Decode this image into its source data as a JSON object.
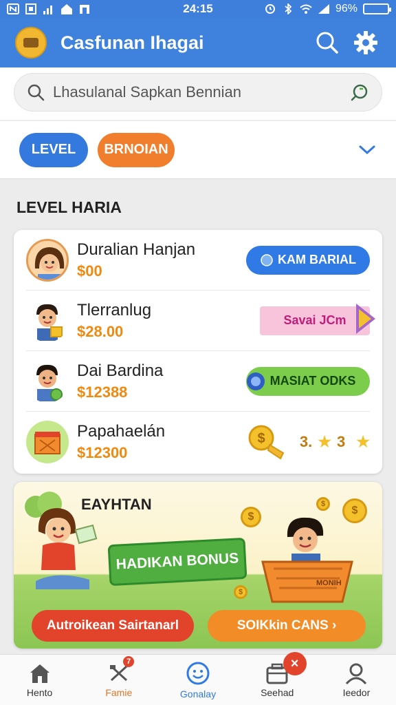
{
  "status_bar": {
    "time": "24:15",
    "battery": "96%"
  },
  "app_bar": {
    "title": "Casfunan Ihagai"
  },
  "search": {
    "placeholder": "Lhasulanal Sapkan Bennian"
  },
  "filters": {
    "chip_level": "LEVEL",
    "chip_bonus": "BRNOIAN"
  },
  "section": {
    "title": "LEVEL HARIA"
  },
  "list": [
    {
      "name": "Duralian Hanjan",
      "amount": "$00",
      "action": "KAM BARIAL"
    },
    {
      "name": "Tlerranlug",
      "amount": "$28.00",
      "action": "Savai JCm"
    },
    {
      "name": "Dai Bardina",
      "amount": "$12388",
      "action": "MASIAT ODKS"
    },
    {
      "name": "Papahaelán",
      "amount": "$12300",
      "rating": "3.",
      "rating_extra": "3"
    }
  ],
  "banner": {
    "title": "EAYHTAN",
    "sign": "HADIKAN BONUS",
    "basket_label": "MONIH",
    "button_left": "Autroikean Sairtanarl",
    "button_right": "SOIKkin CANS ›"
  },
  "bottom_nav": [
    {
      "label": "Hento",
      "icon": "home-icon"
    },
    {
      "label": "Famie",
      "icon": "trophy-icon",
      "badge": "7"
    },
    {
      "label": "Gonalay",
      "icon": "smiley-icon"
    },
    {
      "label": "Seehad",
      "icon": "shop-icon",
      "badge": "×"
    },
    {
      "label": "Ieedor",
      "icon": "profile-icon"
    }
  ],
  "colors": {
    "primary": "#3f82de",
    "accent_orange": "#f07e2d",
    "coin": "#f4c12c"
  }
}
